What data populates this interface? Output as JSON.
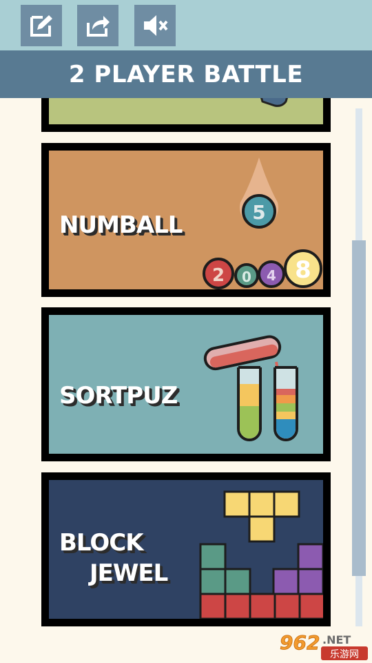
{
  "header": {
    "title": "2 PLAYER BATTLE",
    "buttons": [
      {
        "icon": "edit-icon"
      },
      {
        "icon": "share-icon"
      },
      {
        "icon": "mute-icon"
      }
    ]
  },
  "games": [
    {
      "label": "",
      "color": "#b8c47e"
    },
    {
      "label": "NUMBALL",
      "color": "#cf9560",
      "balls": [
        "5",
        "2",
        "0",
        "4",
        "8"
      ]
    },
    {
      "label": "SORTPUZ",
      "color": "#7eb0b4"
    },
    {
      "label_line1": "BLOCK",
      "label_line2": "JEWEL",
      "color": "#2f4263"
    }
  ],
  "watermark": {
    "brand": "962",
    "suffix": ".NET",
    "subtitle": "乐游网"
  }
}
